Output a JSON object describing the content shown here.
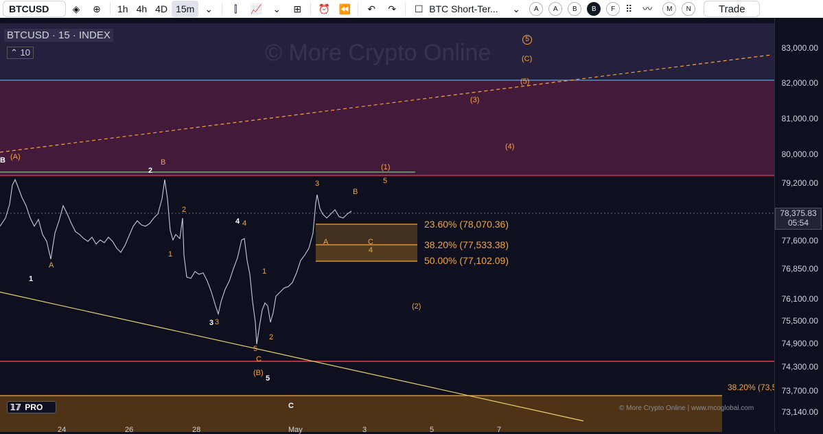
{
  "toolbar": {
    "symbol": "BTCUSD",
    "timeframes": [
      "1h",
      "4h",
      "4D",
      "15m"
    ],
    "active_timeframe": "15m",
    "layout_name": "BTC Short-Ter...",
    "letter_buttons": [
      "A",
      "A",
      "B",
      "B",
      "F"
    ],
    "extra_letters": [
      "M",
      "N"
    ],
    "trade_label": "Trade"
  },
  "legend": {
    "title": "BTCUSD · 15 · INDEX",
    "indicator_count": "10"
  },
  "watermark": "© More Crypto Online",
  "price_axis": {
    "ticks": [
      "83,000.00",
      "82,000.00",
      "81,000.00",
      "80,000.00",
      "79,200.00",
      "77,600.00",
      "76,850.00",
      "76,100.00",
      "75,500.00",
      "74,900.00",
      "74,300.00",
      "73,700.00",
      "73,140.00"
    ],
    "current_price": "78,375.83",
    "countdown": "05:54"
  },
  "time_axis": [
    "24",
    "26",
    "28",
    "May",
    "3",
    "5",
    "7"
  ],
  "fib_levels": [
    {
      "label": "23.60% (78,070.36)"
    },
    {
      "label": "38.20% (77,533.38)"
    },
    {
      "label": "50.00% (77,102.09)"
    }
  ],
  "bottom_fib": "38.20% (73,5",
  "credit": "© More Crypto Online   |   www.mcoglobal.com",
  "logo_text": "PRO",
  "wave_labels": {
    "w1": "B",
    "w2": "2",
    "w3": "1",
    "w4": "4",
    "w5": "3",
    "w6": "5",
    "w7": "C",
    "w8": "3",
    "o1": "(A)",
    "o2": "B",
    "o3": "A",
    "o4": "2",
    "o5": "1",
    "o6": "4",
    "o7": "3",
    "o8": "1",
    "o9": "2",
    "o10": "5",
    "o11": "C",
    "o12": "(B)",
    "o13": "3",
    "o14": "B",
    "o15": "A",
    "o16": "C",
    "o17": "4",
    "o18": "(1)",
    "o19": "5",
    "o20": "(2)",
    "o21": "(3)",
    "o22": "(4)",
    "o23": "(5)",
    "o24": "(C)",
    "o25": "5"
  },
  "colors": {
    "background": "#0e1020",
    "orange": "#f7a43a",
    "red_line": "#e83b4b",
    "blue_line": "#5fa3d8",
    "yellow_line": "#e8d26a"
  }
}
